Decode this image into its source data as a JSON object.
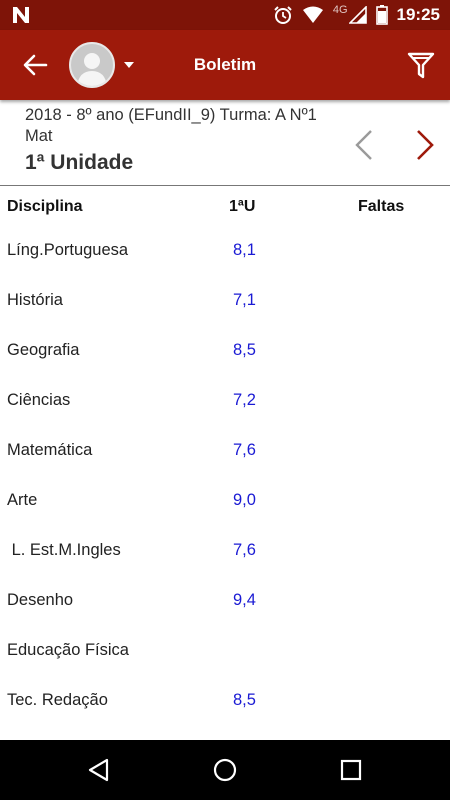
{
  "status_bar": {
    "network_label": "4G",
    "time": "19:25",
    "icons": [
      "n-notification-icon",
      "alarm-icon",
      "wifi-icon",
      "signal-icon",
      "battery-icon"
    ]
  },
  "app_bar": {
    "title": "Boletim",
    "icons": [
      "back-arrow-icon",
      "avatar-icon",
      "dropdown-caret-icon",
      "filter-icon"
    ],
    "color": "#9e1a0b"
  },
  "class_info": {
    "line": "2018 - 8º ano (EFundII_9) Turma: A Nº1 Mat",
    "unit": "1ª Unidade"
  },
  "unit_nav": {
    "prev_icon": "chevron-left-icon",
    "next_icon": "chevron-right-icon"
  },
  "grades_table": {
    "headers": {
      "subject": "Disciplina",
      "unit": "1ªU",
      "absences": "Faltas"
    },
    "rows": [
      {
        "subject": "Líng.Portuguesa",
        "grade": "8,1",
        "absences": ""
      },
      {
        "subject": "História",
        "grade": "7,1",
        "absences": ""
      },
      {
        "subject": "Geografia",
        "grade": "8,5",
        "absences": ""
      },
      {
        "subject": "Ciências",
        "grade": "7,2",
        "absences": ""
      },
      {
        "subject": "Matemática",
        "grade": "7,6",
        "absences": ""
      },
      {
        "subject": "Arte",
        "grade": "9,0",
        "absences": ""
      },
      {
        "subject": " L. Est.M.Ingles",
        "grade": "7,6",
        "absences": ""
      },
      {
        "subject": "Desenho",
        "grade": "9,4",
        "absences": ""
      },
      {
        "subject": "Educação Física",
        "grade": "",
        "absences": ""
      },
      {
        "subject": "Tec. Redação",
        "grade": "8,5",
        "absences": ""
      }
    ],
    "grade_color": "#1a1ad4"
  },
  "nav_bar": {
    "icons": [
      "nav-back-icon",
      "nav-home-icon",
      "nav-recents-icon"
    ]
  }
}
